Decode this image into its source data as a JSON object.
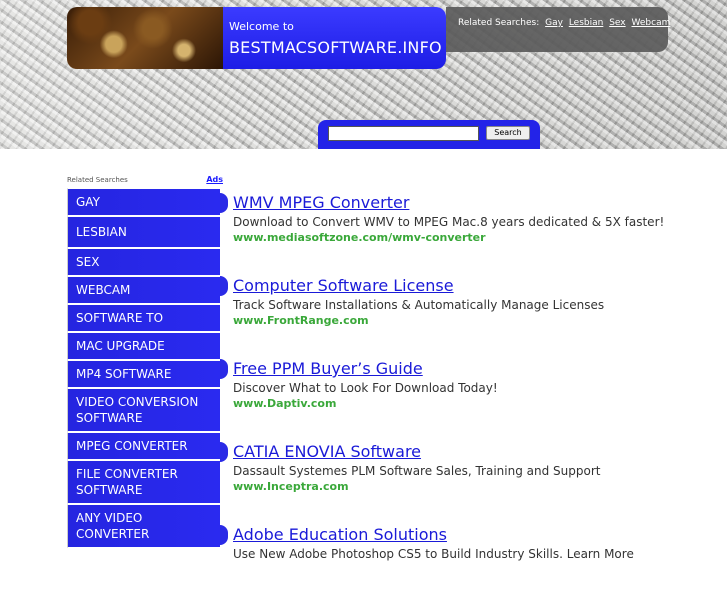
{
  "header": {
    "welcome_small": "Welcome to",
    "welcome_big": "BESTMACSOFTWARE.INFO",
    "related_label": "Related Searches:",
    "related_links": [
      "Gay",
      "Lesbian",
      "Sex",
      "Webcam"
    ],
    "search_button": "Search",
    "search_value": ""
  },
  "sidebar": {
    "title": "Related Searches",
    "ads_label": "Ads",
    "items": [
      "GAY",
      "LESBIAN",
      "SEX",
      "WEBCAM",
      "SOFTWARE TO",
      "MAC UPGRADE",
      "MP4 SOFTWARE",
      "VIDEO CONVERSION SOFTWARE",
      "MPEG CONVERTER",
      "FILE CONVERTER SOFTWARE",
      "ANY VIDEO CONVERTER"
    ]
  },
  "ads": [
    {
      "title": "WMV MPEG Converter",
      "desc": "Download to Convert WMV to MPEG Mac.8 years dedicated & 5X faster!",
      "url": "www.mediasoftzone.com/wmv-converter"
    },
    {
      "title": "Computer Software License",
      "desc": "Track Software Installations & Automatically Manage Licenses",
      "url": "www.FrontRange.com"
    },
    {
      "title": "Free PPM Buyer’s Guide",
      "desc": "Discover What to Look For Download Today!",
      "url": "www.Daptiv.com"
    },
    {
      "title": "CATIA ENOVIA Software",
      "desc": "Dassault Systemes PLM Software Sales, Training and Support",
      "url": "www.Inceptra.com"
    },
    {
      "title": "Adobe Education Solutions",
      "desc": "Use New Adobe Photoshop CS5 to Build Industry Skills. Learn More",
      "url": ""
    }
  ],
  "colors": {
    "accent_blue": "#2323e8",
    "link_blue": "#1a1ad8",
    "url_green": "#3aa83a",
    "related_bg": "#5a5a5a"
  }
}
